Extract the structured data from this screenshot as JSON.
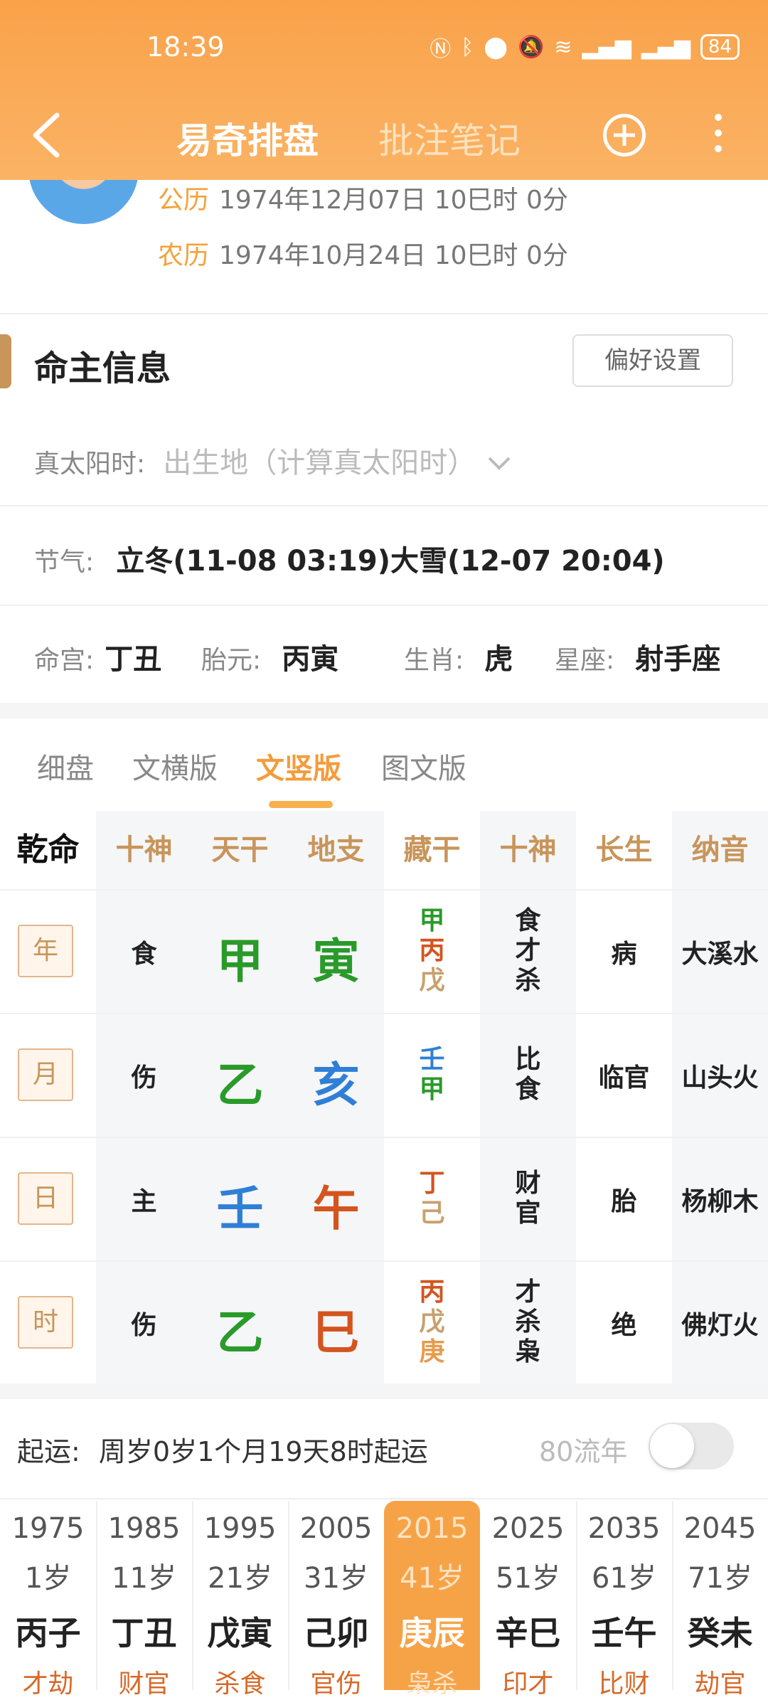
{
  "status_bar": {
    "time": "18:39",
    "battery": "84"
  },
  "nav": {
    "title": "易奇排盘",
    "title2": "批注笔记"
  },
  "profile": {
    "solar_label": "公历",
    "solar_value": "1974年12月07日 10巳时 0分",
    "lunar_label": "农历",
    "lunar_value": "1974年10月24日 10巳时 0分"
  },
  "info": {
    "title": "命主信息",
    "pref_button": "偏好设置",
    "true_solar_label": "真太阳时:",
    "true_solar_value": "出生地（计算真太阳时）",
    "jieqi_label": "节气:",
    "jieqi_value": "立冬(11-08 03:19)大雪(12-07 20:04)",
    "minggong_label": "命宫:",
    "minggong_value": "丁丑",
    "taiyuan_label": "胎元:",
    "taiyuan_value": "丙寅",
    "shengxiao_label": "生肖:",
    "shengxiao_value": "虎",
    "xingzuo_label": "星座:",
    "xingzuo_value": "射手座"
  },
  "tabs": [
    "细盘",
    "文横版",
    "文竖版",
    "图文版"
  ],
  "table": {
    "corner": "乾命",
    "headers": [
      "十神",
      "天干",
      "地支",
      "藏干",
      "十神",
      "长生",
      "纳音"
    ],
    "rows": [
      {
        "pillar": "年",
        "shishen": "食",
        "gan": "甲",
        "zhi": "寅",
        "cang": [
          "甲",
          "丙",
          "戊"
        ],
        "cang_ss": [
          "食",
          "才",
          "杀"
        ],
        "changsheng": "病",
        "nayin": "大溪水"
      },
      {
        "pillar": "月",
        "shishen": "伤",
        "gan": "乙",
        "zhi": "亥",
        "cang": [
          "壬",
          "甲"
        ],
        "cang_ss": [
          "比",
          "食"
        ],
        "changsheng": "临官",
        "nayin": "山头火"
      },
      {
        "pillar": "日",
        "shishen": "主",
        "gan": "壬",
        "zhi": "午",
        "cang": [
          "丁",
          "己"
        ],
        "cang_ss": [
          "财",
          "官"
        ],
        "changsheng": "胎",
        "nayin": "杨柳木"
      },
      {
        "pillar": "时",
        "shishen": "伤",
        "gan": "乙",
        "zhi": "巳",
        "cang": [
          "丙",
          "戊",
          "庚"
        ],
        "cang_ss": [
          "才",
          "杀",
          "枭"
        ],
        "changsheng": "绝",
        "nayin": "佛灯火"
      }
    ]
  },
  "qiyun": {
    "label": "起运:",
    "value": "周岁0岁1个月19天8时起运",
    "liunian_label": "80流年"
  },
  "dayun": [
    {
      "year": "1975",
      "age": "1岁",
      "gz": "丙子",
      "ss": "才劫"
    },
    {
      "year": "1985",
      "age": "11岁",
      "gz": "丁丑",
      "ss": "财官"
    },
    {
      "year": "1995",
      "age": "21岁",
      "gz": "戊寅",
      "ss": "杀食"
    },
    {
      "year": "2005",
      "age": "31岁",
      "gz": "己卯",
      "ss": "官伤"
    },
    {
      "year": "2015",
      "age": "41岁",
      "gz": "庚辰",
      "ss": "枭杀"
    },
    {
      "year": "2025",
      "age": "51岁",
      "gz": "辛巳",
      "ss": "印才"
    },
    {
      "year": "2035",
      "age": "61岁",
      "gz": "壬午",
      "ss": "比财"
    },
    {
      "year": "2045",
      "age": "71岁",
      "gz": "癸未",
      "ss": "劫官"
    }
  ],
  "colors": {
    "accent": "#f39c3b",
    "wood": "#2a9a2a",
    "water": "#2f7fd6",
    "fire": "#d4541e",
    "earth": "#c8a06e",
    "metal": "#e69b4d"
  }
}
